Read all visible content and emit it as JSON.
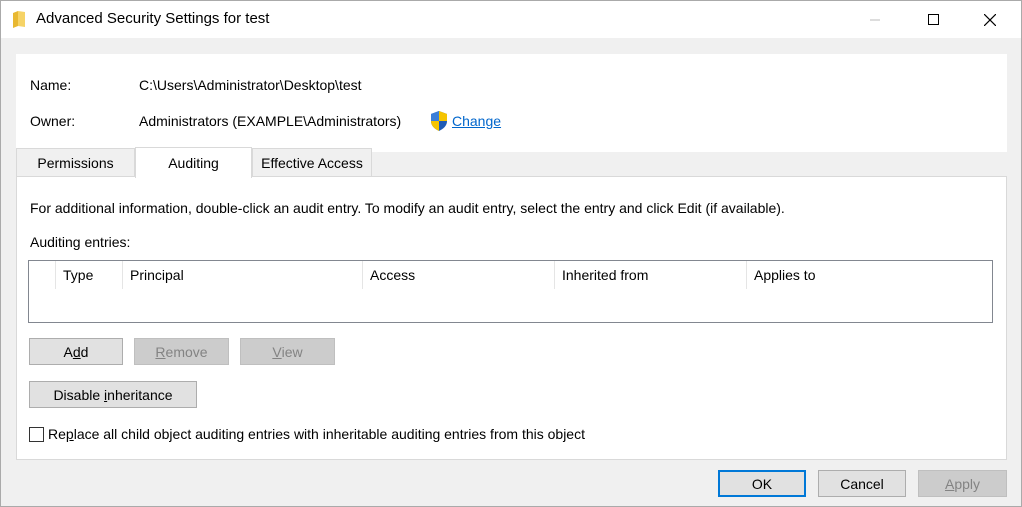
{
  "window": {
    "title": "Advanced Security Settings for test"
  },
  "header": {
    "name_label": "Name:",
    "name_value": "C:\\Users\\Administrator\\Desktop\\test",
    "owner_label": "Owner:",
    "owner_value": "Administrators (EXAMPLE\\Administrators)",
    "change_link": "Change"
  },
  "tabs": [
    {
      "label": "Permissions",
      "active": false
    },
    {
      "label": "Auditing",
      "active": true
    },
    {
      "label": "Effective Access",
      "active": false
    }
  ],
  "auditing": {
    "info_text": "For additional information, double-click an audit entry. To modify an audit entry, select the entry and click Edit (if available).",
    "entries_label": "Auditing entries:",
    "columns": [
      "",
      "Type",
      "Principal",
      "Access",
      "Inherited from",
      "Applies to"
    ],
    "rows": [],
    "buttons": {
      "add": {
        "pre": "A",
        "key": "d",
        "post": "d"
      },
      "remove": {
        "pre": "",
        "key": "R",
        "post": "emove"
      },
      "view": {
        "pre": "",
        "key": "V",
        "post": "iew"
      },
      "disable_inheritance": {
        "pre": "Disable ",
        "key": "i",
        "post": "nheritance"
      }
    },
    "replace_checkbox": {
      "pre": "Re",
      "key": "p",
      "post": "lace all child object auditing entries with inheritable auditing entries from this object",
      "checked": false
    }
  },
  "footer": {
    "ok": "OK",
    "cancel": "Cancel",
    "apply": {
      "pre": "",
      "key": "A",
      "post": "pply"
    }
  },
  "colors": {
    "link": "#0066cc",
    "default_button_border": "#0078d7",
    "disabled_text": "#838383"
  }
}
